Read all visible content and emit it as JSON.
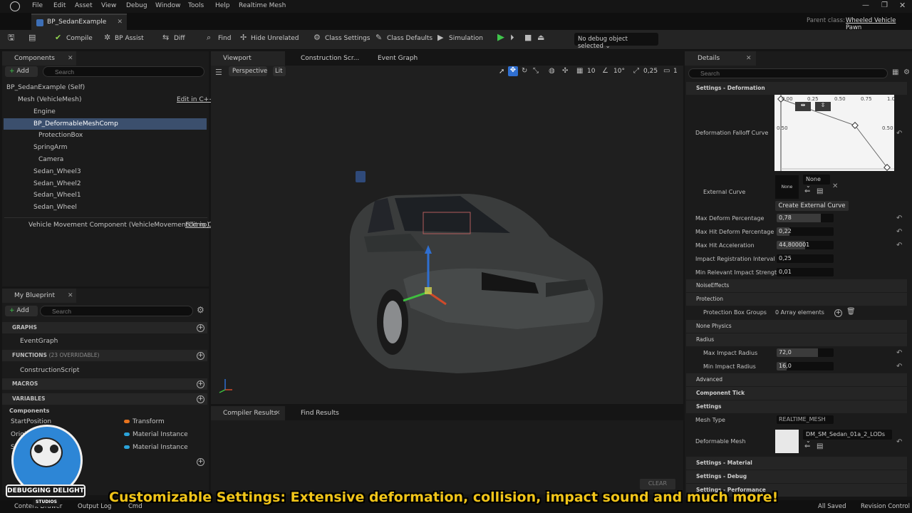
{
  "menu": [
    "File",
    "Edit",
    "Asset",
    "View",
    "Debug",
    "Window",
    "Tools",
    "Help",
    "Realtime Mesh"
  ],
  "parent_class_label": "Parent class:",
  "parent_class": "Wheeled Vehicle Pawn",
  "doc_tab": "BP_SedanExample",
  "toolbar": {
    "compile": "Compile",
    "bp_assist": "BP Assist",
    "diff": "Diff",
    "find": "Find",
    "hide_unrelated": "Hide Unrelated",
    "class_settings": "Class Settings",
    "class_defaults": "Class Defaults",
    "simulation": "Simulation",
    "debug_object": "No debug object selected"
  },
  "components": {
    "tab": "Components",
    "add": "Add",
    "search_placeholder": "Search",
    "items": [
      "BP_SedanExample (Self)",
      "Mesh (VehicleMesh)",
      "Engine",
      "BP_DeformableMeshComp",
      "ProtectionBox",
      "SpringArm",
      "Camera",
      "Sedan_Wheel3",
      "Sedan_Wheel2",
      "Sedan_Wheel1",
      "Sedan_Wheel",
      "Vehicle Movement Component (VehicleMovementComp)"
    ],
    "edit_cpp": "Edit in C++",
    "edit_c": "Edit in C"
  },
  "viewport": {
    "tabs": [
      "Viewport",
      "Construction Scr...",
      "Event Graph"
    ],
    "perspective": "Perspective",
    "lit": "Lit",
    "grid": "10",
    "angle": "10°",
    "scale": "0,25",
    "cam": "1"
  },
  "bottom": {
    "tabs": [
      "Compiler Results",
      "Find Results"
    ],
    "clear": "CLEAR"
  },
  "my_blueprint": {
    "tab": "My Blueprint",
    "add": "Add",
    "search_placeholder": "Search",
    "graphs": "GRAPHS",
    "event_graph": "EventGraph",
    "functions": "FUNCTIONS",
    "overridable": "(23 OVERRIDABLE)",
    "construction_script": "ConstructionScript",
    "macros": "MACROS",
    "variables": "VARIABLES",
    "components": "Components",
    "vars": [
      {
        "name": "StartPosition",
        "type": "Transform",
        "color": "#e8741e"
      },
      {
        "name": "Origina...",
        "type": "Material Instance",
        "color": "#2ba3d9"
      },
      {
        "name": "S...",
        "type": "Material Instance",
        "color": "#2ba3d9"
      }
    ]
  },
  "details": {
    "tab": "Details",
    "search_placeholder": "Search",
    "settings_deformation": "Settings - Deformation",
    "falloff_curve": "Deformation Falloff Curve",
    "curve_top_labels": [
      "0.00",
      "0.25",
      "0.50",
      "0.75",
      "1.0"
    ],
    "curve_mid": "0.50",
    "external_curve": "External Curve",
    "none": "None",
    "none_dd": "None",
    "create_external_curve": "Create External Curve",
    "props": [
      {
        "label": "Max Deform Percentage",
        "value": "0,78",
        "fill": 0.78
      },
      {
        "label": "Max Hit Deform Percentage",
        "value": "0,22",
        "fill": 0.22
      },
      {
        "label": "Max Hit Acceleration",
        "value": "44,800001",
        "fill": 0.5
      },
      {
        "label": "Impact Registration Interval",
        "value": "0,25",
        "fill": 0
      },
      {
        "label": "Min Relevant Impact Strength",
        "value": "0,01",
        "fill": 0
      }
    ],
    "noise_effects": "NoiseEffects",
    "protection": "Protection",
    "protection_box_groups": "Protection Box Groups",
    "array_elements": "0 Array elements",
    "none_physics": "None Physics",
    "radius": "Radius",
    "max_impact_radius": "Max Impact Radius",
    "max_impact_radius_value": "72,0",
    "min_impact_radius": "Min Impact Radius",
    "min_impact_radius_value": "16,0",
    "advanced": "Advanced",
    "component_tick": "Component Tick",
    "settings": "Settings",
    "mesh_type": "Mesh Type",
    "mesh_type_value": "REALTIME_MESH",
    "deformable_mesh": "Deformable Mesh",
    "deformable_mesh_value": "DM_SM_Sedan_01a_2_LODs",
    "settings_material": "Settings - Material",
    "settings_debug": "Settings - Debug",
    "settings_performance": "Settings - Performance"
  },
  "status": {
    "content_drawer": "Content Drawer",
    "output_log": "Output Log",
    "cmd": "Cmd",
    "all_saved": "All Saved",
    "revision_control": "Revision Control"
  },
  "logo": {
    "line1": "DEBUGGING DELIGHT",
    "line2": "STUDIOS"
  },
  "caption": "Customizable Settings: Extensive deformation, collision, impact sound and much more!"
}
